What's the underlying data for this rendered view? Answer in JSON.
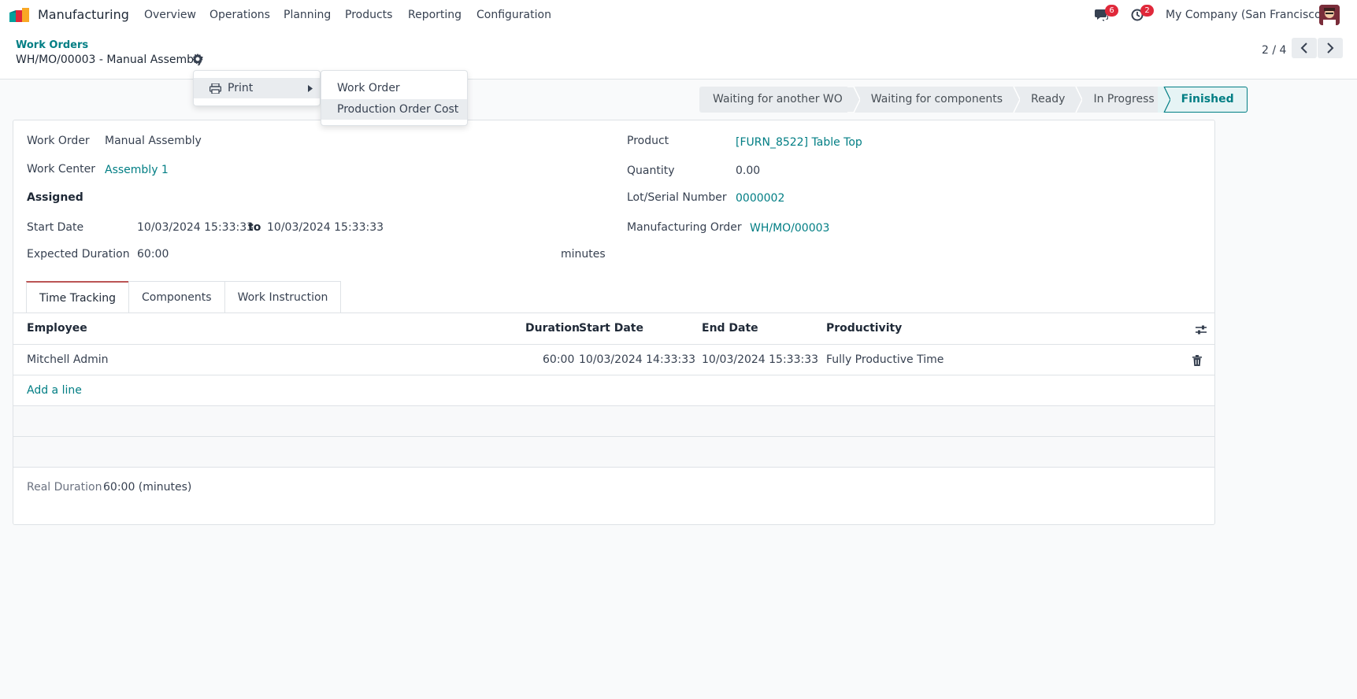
{
  "nav": {
    "app_name": "Manufacturing",
    "menus": [
      "Overview",
      "Operations",
      "Planning",
      "Products",
      "Reporting",
      "Configuration"
    ],
    "messages_count": "6",
    "activities_count": "2",
    "company": "My Company (San Francisco)"
  },
  "breadcrumb": {
    "parent": "Work Orders",
    "current": "WH/MO/00003 - Manual Assembly"
  },
  "pager": {
    "value": "2 / 4"
  },
  "action_menu": {
    "print_label": "Print",
    "print_items": [
      "Work Order",
      "Production Order Cost"
    ]
  },
  "statusbar": {
    "stages": [
      "Waiting for another WO",
      "Waiting for components",
      "Ready",
      "In Progress",
      "Finished"
    ],
    "active": "Finished"
  },
  "form": {
    "work_order_label": "Work Order",
    "work_order": "Manual Assembly",
    "work_center_label": "Work Center",
    "work_center": "Assembly 1",
    "assigned_label": "Assigned",
    "start_date_label": "Start Date",
    "start_date": "10/03/2024 15:33:33",
    "to_label": "to",
    "end_date": "10/03/2024 15:33:33",
    "expected_duration_label": "Expected Duration",
    "expected_duration": "60:00",
    "minutes_label": "minutes",
    "product_label": "Product",
    "product": "[FURN_8522] Table Top",
    "quantity_label": "Quantity",
    "quantity": "0.00",
    "lot_label": "Lot/Serial Number",
    "lot": "0000002",
    "mo_label": "Manufacturing Order",
    "mo": "WH/MO/00003"
  },
  "tabs": [
    "Time Tracking",
    "Components",
    "Work Instruction"
  ],
  "time_table": {
    "headers": {
      "employee": "Employee",
      "duration": "Duration",
      "start": "Start Date",
      "end": "End Date",
      "productivity": "Productivity"
    },
    "rows": [
      {
        "employee": "Mitchell Admin",
        "duration": "60:00",
        "start": "10/03/2024 14:33:33",
        "end": "10/03/2024 15:33:33",
        "productivity": "Fully Productive Time"
      }
    ],
    "add_line": "Add a line"
  },
  "real_duration": {
    "label": "Real Duration",
    "value": "60:00 (minutes)"
  },
  "colors": {
    "accent": "#017e84",
    "badge": "#e0283a",
    "brand_logo": [
      "#f9a825",
      "#e0283a",
      "#00a09d"
    ]
  }
}
